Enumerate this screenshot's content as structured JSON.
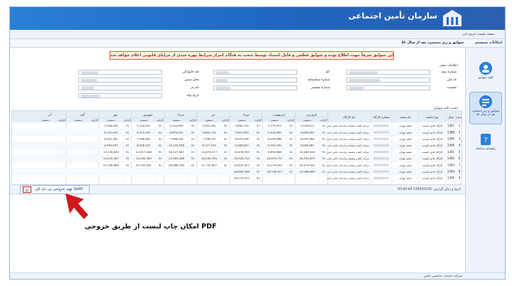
{
  "header": {
    "title": "سازمان تأمین اجتماعی"
  },
  "userbar": {
    "links": "صفحه نخست   خروج امن"
  },
  "breadcrumb": {
    "title": "سوابق و ریز دستمزد بعد از سال ۸۶",
    "section": "امکانات سیستم"
  },
  "sidebar": {
    "items": [
      {
        "label": "کلیه سوابق"
      },
      {
        "label": "سوابق و ریز دستمزد بعد از سال ۸۶"
      },
      {
        "label": "راهنمای سامانه"
      }
    ]
  },
  "warning": "این سوابق صرفاً جهت اطلاع بوده و سوابق قطعی و قابل استناد توسط شعب به هنگام احراز شرایط بهره مندی از مزایای قانونی اعلام خواهد شد",
  "filters": {
    "legend": "اطلاعات فیلتر",
    "labels": {
      "insurance_no": "شماره بیمه",
      "first_name": "نام",
      "last_name": "نام خانوادگی",
      "national_code": "کد ملی",
      "id_number": "شماره شناسنامه",
      "father_name": "نام پدر",
      "birth_date": "تاریخ تولد",
      "register_no": "شماره مستمر",
      "issue_place": "محل صدور",
      "gender": "جنسیت"
    }
  },
  "list_label": "لیست کلیه سوابق",
  "table": {
    "fixed_headers": [
      "ردیف",
      "سال",
      "نوع سابقه",
      "نام شعبه",
      "شماره کارگاه",
      "نام کارگاه"
    ],
    "months": [
      "فروردین",
      "اردیبهشت",
      "خرداد",
      "تیر",
      "مرداد",
      "شهریور",
      "مهر",
      "آبان",
      "آذر"
    ],
    "sub_headers": [
      "کارکرد",
      "دستمزد"
    ],
    "workshop_name": "شرکت کشت وصنعت وخدمات جانبی نامی",
    "rows": [
      {
        "row": "1",
        "year": "1387",
        "type": "کارگاه عادی کیست",
        "branch": "شعبه تهران",
        "wage": [
          "3,235,611",
          "3,175,953",
          "3,965,230",
          "3,453,461",
          "3,143,659",
          "3,134,001",
          "3,348,163"
        ]
      },
      {
        "row": "2",
        "year": "1388",
        "type": "کارگاه عادی کیست",
        "branch": "شعبه تهران",
        "wage": [
          "4,964,005",
          "5,318,365",
          "5,957,833",
          "5,632,719",
          "6,679,532",
          "6,172,041",
          "6,172,041"
        ]
      },
      {
        "row": "3",
        "year": "1389",
        "type": "کارگاه عادی کیست",
        "branch": "شعبه تهران",
        "wage": [
          "6,335,266",
          "6,026,088",
          "6,455,944",
          "7,708,252",
          "7,498,202",
          "7,408,842",
          "8,252,361"
        ]
      },
      {
        "row": "4",
        "year": "1390",
        "type": "کارگاه عادی کیست",
        "branch": "شعبه تهران",
        "wage": [
          "8,289,067",
          "9,743,330",
          "9,348,633",
          "6,727,919",
          "10,129,558",
          "8,928,101",
          "9,040,947"
        ]
      },
      {
        "row": "5",
        "year": "1391",
        "type": "کارگاه عادی کیست",
        "branch": "شعبه تهران",
        "wage": [
          "12,485,940",
          "9,894,868",
          "10,633,393",
          "10,679,077",
          "26,247,087",
          "12,917,448",
          "13,376,633"
        ]
      },
      {
        "row": "6",
        "year": "1392",
        "type": "کارگاه عادی کیست",
        "branch": "شعبه تهران",
        "wage": [
          "16,395,879",
          "18,979,772",
          "15,304,714",
          "18,294,739",
          "22,963,458",
          "14,195,780",
          "14,575,287"
        ]
      },
      {
        "row": "7",
        "year": "1393",
        "type": "کارگاه عادی کیست",
        "branch": "شعبه تهران",
        "wage": [
          "20,974,420",
          "20,274,432",
          "20,597,927",
          "21,773,607",
          "28,968,756",
          "20,335,591",
          "21,936,666"
        ]
      },
      {
        "row": "8",
        "year": "1394",
        "type": "کارگاه عادی کیست",
        "branch": "شعبه تهران",
        "wage": [
          "24,080,894",
          "26,738,327",
          "28,465,586",
          "",
          "",
          "",
          ""
        ]
      },
      {
        "row": "9",
        "year": "1395",
        "type": "کارگاه عادی کیست",
        "branch": "شعبه تهران",
        "wage": [
          "",
          "",
          "30,074,411",
          "",
          "",
          "",
          ""
        ]
      }
    ]
  },
  "pdf_button": "تهیه خروجی پی دی اف (pdf)",
  "report_date": "تاریخ و زمان گزارش: 1395/05/26 05:00:44",
  "annotation": "امکان چاپ لیست از طریق خروجی PDF",
  "status": "شرکت خدمات ماشینی تامین",
  "colors": {
    "banner": "#1f67c0",
    "warning": "#c0201a",
    "arrow": "#d0191b"
  }
}
